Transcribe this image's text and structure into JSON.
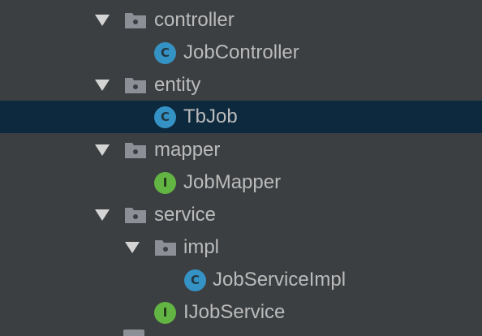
{
  "tree": {
    "items": [
      {
        "label": "controller",
        "kind": "folder",
        "expanded": true
      },
      {
        "label": "JobController",
        "kind": "class",
        "icon_letter": "C"
      },
      {
        "label": "entity",
        "kind": "folder",
        "expanded": true
      },
      {
        "label": "TbJob",
        "kind": "class",
        "icon_letter": "C",
        "selected": true
      },
      {
        "label": "mapper",
        "kind": "folder",
        "expanded": true
      },
      {
        "label": "JobMapper",
        "kind": "interface",
        "icon_letter": "I"
      },
      {
        "label": "service",
        "kind": "folder",
        "expanded": true
      },
      {
        "label": "impl",
        "kind": "folder",
        "expanded": true
      },
      {
        "label": "JobServiceImpl",
        "kind": "class",
        "icon_letter": "C"
      },
      {
        "label": "IJobService",
        "kind": "interface",
        "icon_letter": "I"
      }
    ]
  },
  "colors": {
    "background": "#3c3f41",
    "selection": "#0d293e",
    "class_icon": "#3592c4",
    "interface_icon": "#62b543",
    "folder_icon": "#8c9096",
    "text": "#bbbbbb"
  }
}
